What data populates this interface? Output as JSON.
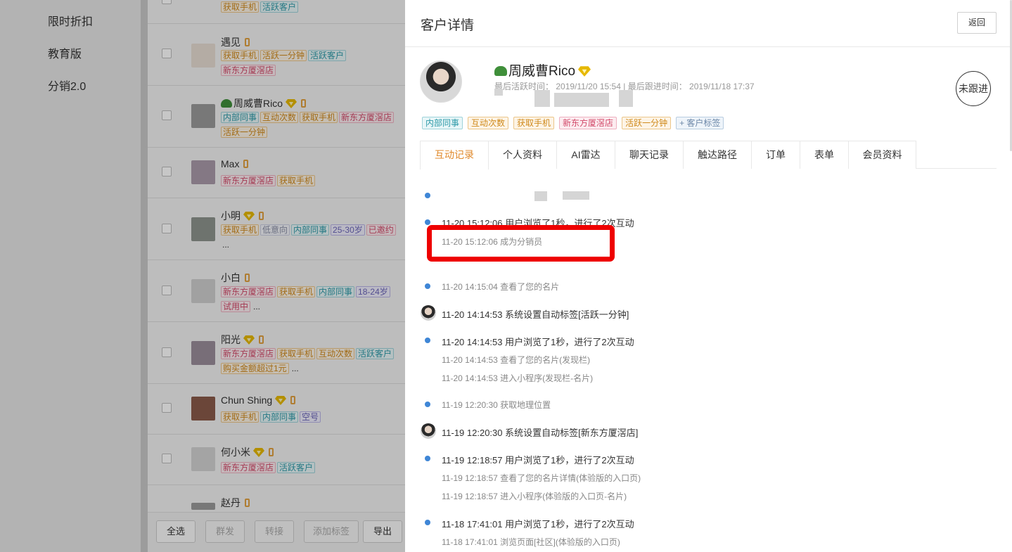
{
  "nav": {
    "items": [
      "限时折扣",
      "教育版",
      "分销2.0"
    ]
  },
  "customers": [
    {
      "name": "",
      "tags": [
        "获取手机",
        "活跃客户"
      ]
    },
    {
      "name": "遇见",
      "tags": [
        "获取手机",
        "活跃一分钟",
        "活跃客户",
        "新东方厦滘店"
      ]
    },
    {
      "name": "周威曹Rico",
      "tags": [
        "内部同事",
        "互动次数",
        "获取手机",
        "新东方厦滘店",
        "活跃一分钟"
      ]
    },
    {
      "name": "Max",
      "tags": [
        "新东方厦滘店",
        "获取手机"
      ]
    },
    {
      "name": "小明",
      "tags": [
        "获取手机",
        "低意向",
        "内部同事",
        "25-30岁",
        "已邀约"
      ],
      "more": "..."
    },
    {
      "name": "小白",
      "tags": [
        "新东方厦滘店",
        "获取手机",
        "内部同事",
        "18-24岁",
        "试用中"
      ],
      "more": "..."
    },
    {
      "name": "阳光",
      "tags": [
        "新东方厦滘店",
        "获取手机",
        "互动次数",
        "活跃客户",
        "购买金额超过1元"
      ],
      "more": "..."
    },
    {
      "name": "Chun Shing",
      "tags": [
        "获取手机",
        "内部同事",
        "空号"
      ]
    },
    {
      "name": "何小米",
      "tags": [
        "新东方厦滘店",
        "活跃客户"
      ]
    },
    {
      "name": "赵丹",
      "tags": []
    }
  ],
  "bottom_bar": {
    "select_all": "全选",
    "mass_send": "群发",
    "transfer": "转接",
    "add_tag": "添加标签",
    "export": "导出"
  },
  "drawer": {
    "title": "客户详情",
    "back_label": "返回",
    "customer": {
      "name": "周威曹Rico",
      "last_active_label": "最后活跃时间：",
      "last_active": "2019/11/20 15:54",
      "last_follow_label": "最后跟进时间：",
      "last_follow": "2019/11/18 17:37",
      "status": "未跟进"
    },
    "tags": [
      "内部同事",
      "互动次数",
      "获取手机",
      "新东方厦滘店",
      "活跃一分钟"
    ],
    "add_tag_label": "+ 客户标签",
    "tabs": [
      "互动记录",
      "个人资料",
      "AI雷达",
      "聊天记录",
      "触达路径",
      "订单",
      "表单",
      "会员资料"
    ],
    "timeline": [
      {
        "kind": "main",
        "text": "11-20 15:12:06 用户浏览了1秒，进行了2次互动"
      },
      {
        "kind": "sub",
        "text": "11-20 15:12:06 成为分销员"
      },
      {
        "kind": "sub",
        "text": "11-20 14:15:04 查看了您的名片"
      },
      {
        "kind": "main",
        "text": "11-20 14:14:53 系统设置自动标签[活跃一分钟]"
      },
      {
        "kind": "main",
        "text": "11-20 14:14:53 用户浏览了1秒，进行了2次互动"
      },
      {
        "kind": "sub",
        "text": "11-20 14:14:53 查看了您的名片(发现栏)"
      },
      {
        "kind": "sub",
        "text": "11-20 14:14:53 进入小程序(发现栏-名片)"
      },
      {
        "kind": "sub",
        "text": "11-19 12:20:30 获取地理位置"
      },
      {
        "kind": "main",
        "text": "11-19 12:20:30 系统设置自动标签[新东方厦滘店]"
      },
      {
        "kind": "main",
        "text": "11-19 12:18:57 用户浏览了1秒，进行了2次互动"
      },
      {
        "kind": "sub",
        "text": "11-19 12:18:57 查看了您的名片详情(体验版的入口页)"
      },
      {
        "kind": "sub",
        "text": "11-19 12:18:57 进入小程序(体验版的入口页-名片)"
      },
      {
        "kind": "main",
        "text": "11-18 17:41:01 用户浏览了1秒，进行了2次互动"
      },
      {
        "kind": "sub",
        "text": "11-18 17:41:01 浏览页面[社区](体验版的入口页)"
      }
    ]
  },
  "colors": {
    "accent": "#e08a2c",
    "timeline_dot": "#3f86d6",
    "highlight": "#ee0000"
  }
}
